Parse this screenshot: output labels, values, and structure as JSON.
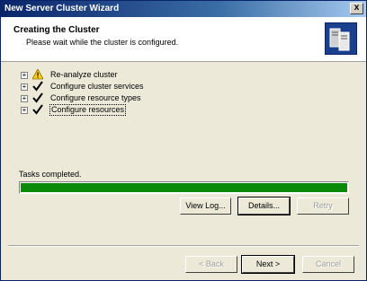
{
  "window": {
    "title": "New Server Cluster Wizard",
    "close_label": "x"
  },
  "header": {
    "title": "Creating the Cluster",
    "subtitle": "Please wait while the cluster is configured."
  },
  "tasks": [
    {
      "label": "Re-analyze cluster",
      "status": "warning",
      "icon": "warning-icon"
    },
    {
      "label": "Configure cluster services",
      "status": "done",
      "icon": "checkmark-icon"
    },
    {
      "label": "Configure resource types",
      "status": "done",
      "icon": "checkmark-icon"
    },
    {
      "label": "Configure resources",
      "status": "done",
      "icon": "checkmark-icon",
      "selected": true
    }
  ],
  "expander_symbol": "+",
  "status_text": "Tasks completed.",
  "progress": {
    "fraction": 1.0,
    "color": "#0a8a0a"
  },
  "actions": {
    "view_log": "View Log...",
    "details": "Details...",
    "retry": "Retry"
  },
  "nav": {
    "back": "< Back",
    "next": "Next >",
    "cancel": "Cancel"
  }
}
